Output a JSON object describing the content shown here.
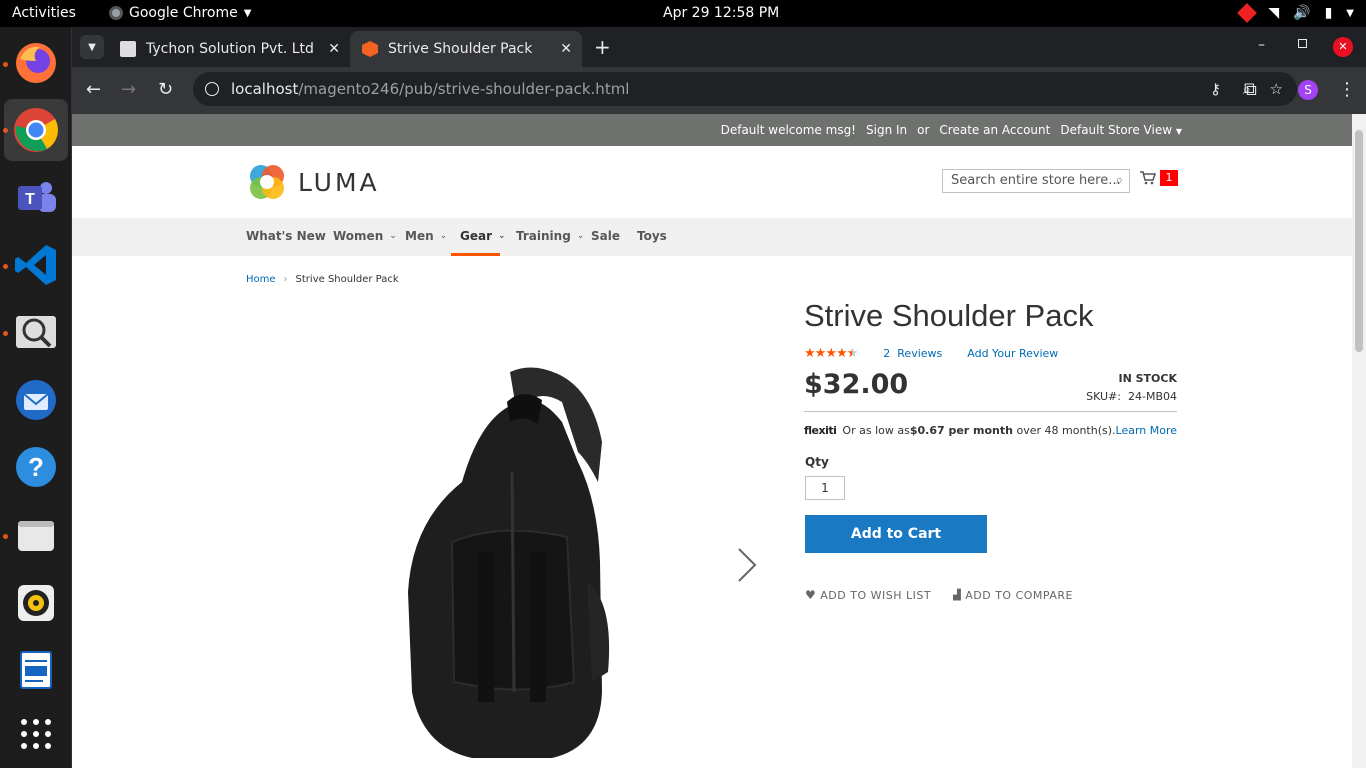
{
  "system": {
    "activities": "Activities",
    "app_name": "Google Chrome",
    "clock": "Apr 29  12:58 PM"
  },
  "browser": {
    "tabs": [
      {
        "title": "Tychon Solution Pvt. Ltd"
      },
      {
        "title": "Strive Shoulder Pack"
      }
    ],
    "url_host": "localhost",
    "url_path": "/magento246/pub/strive-shoulder-pack.html",
    "profile_initial": "S"
  },
  "panel": {
    "welcome": "Default welcome msg!",
    "sign_in": "Sign In",
    "or": "or",
    "create_account": "Create an Account",
    "store_view": "Default Store View"
  },
  "header": {
    "logo_text": "LUMA",
    "search_placeholder": "Search entire store here...",
    "cart_count": "1"
  },
  "nav": {
    "items": [
      "What's New",
      "Women",
      "Men",
      "Gear",
      "Training",
      "Sale",
      "Toys"
    ],
    "active": "Gear"
  },
  "breadcrumb": {
    "home": "Home",
    "current": "Strive Shoulder Pack"
  },
  "product": {
    "name": "Strive Shoulder Pack",
    "rating_stars": 4.5,
    "reviews_count": "2",
    "reviews_label": "Reviews",
    "add_review": "Add Your Review",
    "price": "$32.00",
    "stock": "IN STOCK",
    "sku_label": "SKU#:",
    "sku": "24-MB04",
    "flexiti_brand": "flexiti",
    "flexiti_prefix": "Or as low as",
    "flexiti_amount": "$0.67 per month",
    "flexiti_suffix": "over 48 month(s).",
    "learn_more": "Learn More",
    "qty_label": "Qty",
    "qty_value": "1",
    "add_to_cart": "Add to Cart",
    "add_to_wishlist": "ADD TO WISH LIST",
    "add_to_compare": "ADD TO COMPARE"
  },
  "colors": {
    "accent_blue": "#1979c3",
    "link": "#006bb4",
    "star": "#ff5501",
    "nav_active_underline": "#ff5501"
  }
}
